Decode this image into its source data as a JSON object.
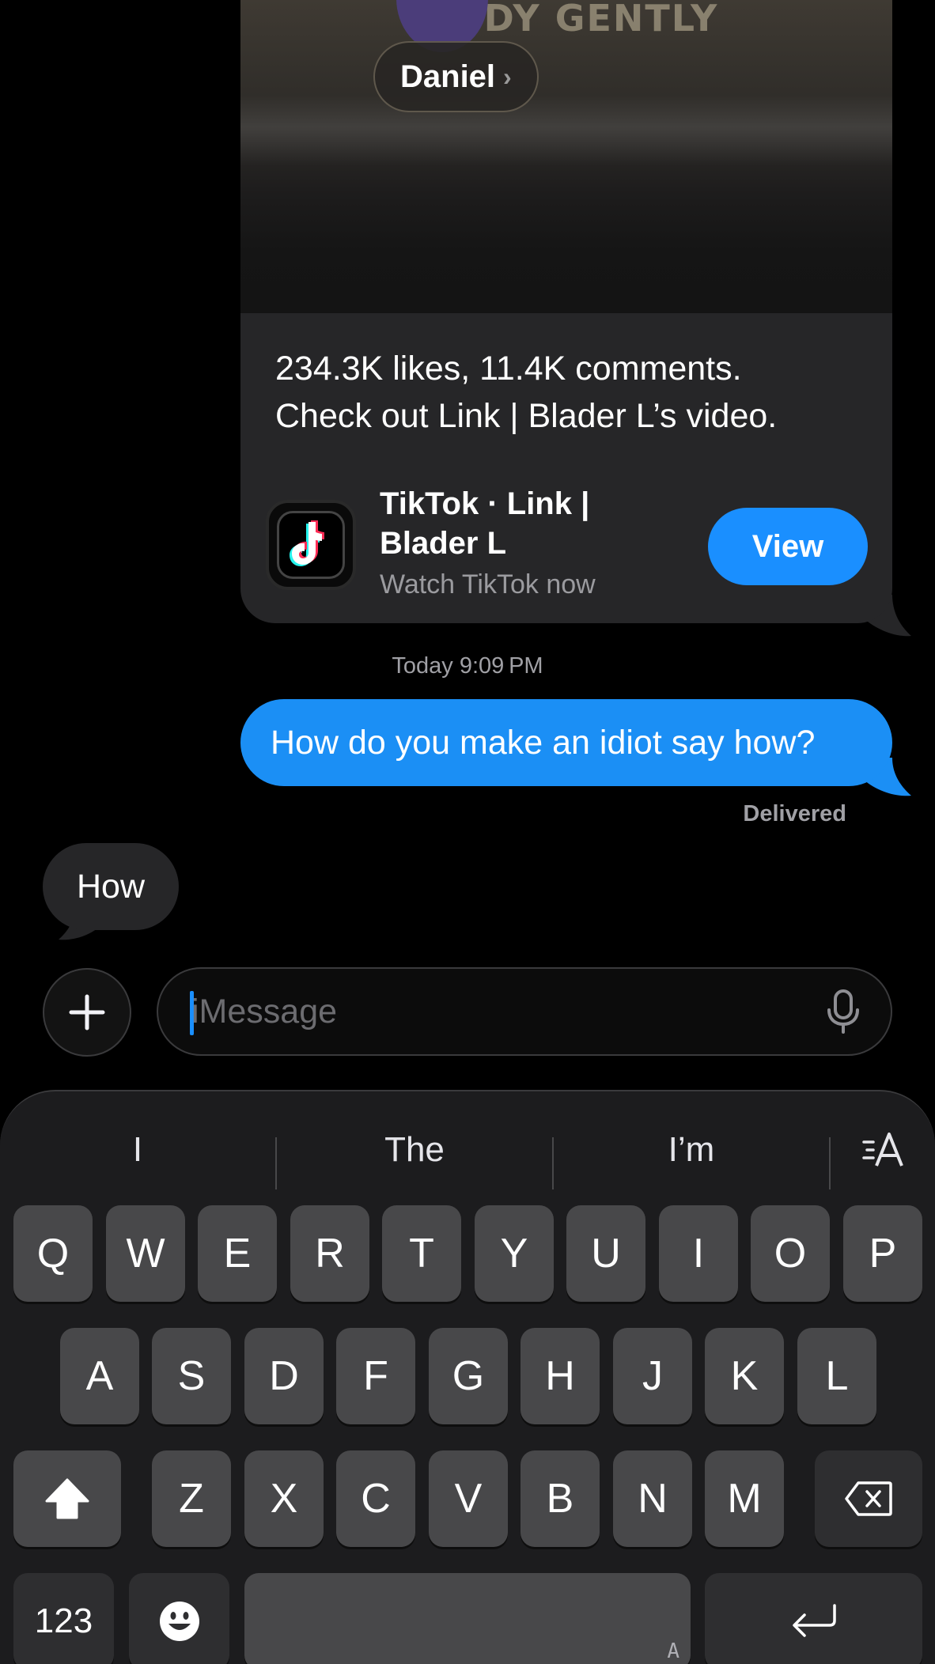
{
  "link_preview": {
    "media_overlay_text": "TH  DY GENTLY",
    "sender_name": "Daniel",
    "sender_chevron": "›",
    "description_lines": [
      "234.3K likes, 11.4K comments.",
      "Check out Link | Blader L’s video."
    ],
    "title_lines": [
      "TikTok · Link |",
      "Blader L"
    ],
    "subtitle": "Watch TikTok now",
    "view_label": "View",
    "app_icon": "tiktok-logo-icon"
  },
  "timestamp": "Today 9:09 PM",
  "outgoing_message": "How do you make an idiot say how?",
  "delivery_status": "Delivered",
  "incoming_message": "How",
  "composer": {
    "placeholder": "iMessage",
    "plus_icon": "plus-icon",
    "mic_icon": "microphone-icon"
  },
  "keyboard": {
    "suggestions": [
      "I",
      "The",
      "I’m"
    ],
    "format_icon": "text-format-icon",
    "row1": [
      "Q",
      "W",
      "E",
      "R",
      "T",
      "Y",
      "U",
      "I",
      "O",
      "P"
    ],
    "row2": [
      "A",
      "S",
      "D",
      "F",
      "G",
      "H",
      "J",
      "K",
      "L"
    ],
    "row3": [
      "Z",
      "X",
      "C",
      "V",
      "B",
      "N",
      "M"
    ],
    "numbers_label": "123",
    "space_hint": "A",
    "shift_icon": "shift-icon",
    "delete_icon": "delete-icon",
    "emoji_icon": "emoji-icon",
    "return_icon": "return-icon"
  },
  "colors": {
    "accent_blue": "#1a8fff",
    "outgoing_bubble": "#1b8ff5",
    "incoming_bubble": "#262628",
    "key_background": "#48484a"
  }
}
